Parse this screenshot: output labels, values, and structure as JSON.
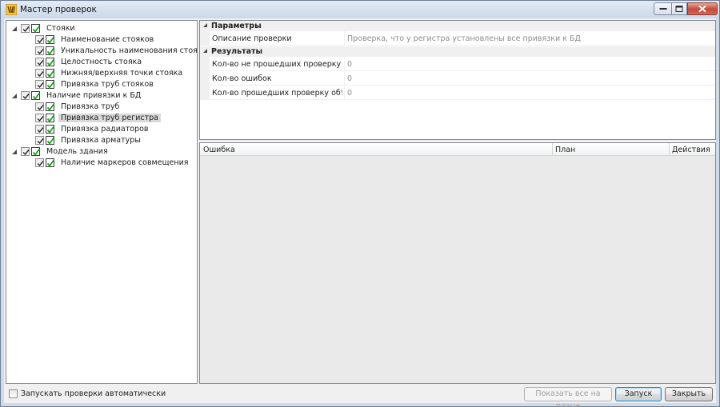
{
  "window": {
    "title": "Мастер проверок"
  },
  "tree": [
    {
      "label": "Стояки",
      "level": 0,
      "checked": true
    },
    {
      "label": "Наименование стояков",
      "level": 1,
      "checked": true
    },
    {
      "label": "Уникальность наименования стояков",
      "level": 1,
      "checked": true
    },
    {
      "label": "Целостность стояка",
      "level": 1,
      "checked": true
    },
    {
      "label": "Нижняя/верхняя точки стояка",
      "level": 1,
      "checked": true
    },
    {
      "label": "Привязка труб стояков",
      "level": 1,
      "checked": true
    },
    {
      "label": "Наличие привязки к БД",
      "level": 0,
      "checked": true
    },
    {
      "label": "Привязка труб",
      "level": 1,
      "checked": true
    },
    {
      "label": "Привязка труб регистра",
      "level": 1,
      "checked": true,
      "selected": true
    },
    {
      "label": "Привязка радиаторов",
      "level": 1,
      "checked": true
    },
    {
      "label": "Привязка арматуры",
      "level": 1,
      "checked": true
    },
    {
      "label": "Модель здания",
      "level": 0,
      "checked": true
    },
    {
      "label": "Наличие маркеров совмещения",
      "level": 1,
      "checked": true
    }
  ],
  "properties": {
    "params_category": "Параметры",
    "description_name": "Описание проверки",
    "description_value": "Проверка, что у регистра установлены все привязки к БД",
    "results_category": "Результаты",
    "failed_name": "Кол-во не прошедших проверку об...",
    "failed_value": "0",
    "errors_name": "Кол-во ошибок",
    "errors_value": "0",
    "passed_name": "Кол-во прошедших проверку объек...",
    "passed_value": "0"
  },
  "errors_table": {
    "columns": [
      "Ошибка",
      "План",
      "Действия"
    ],
    "rows": []
  },
  "footer": {
    "auto_run_label": "Запускать проверки автоматически",
    "auto_run_checked": false,
    "show_all_label": "Показать все на плане",
    "run_label": "Запуск",
    "close_label": "Закрыть"
  },
  "colors": {
    "check_green": "#1aa51a",
    "selection_bg": "#d9d9d9",
    "close_button": "#c4483a"
  }
}
